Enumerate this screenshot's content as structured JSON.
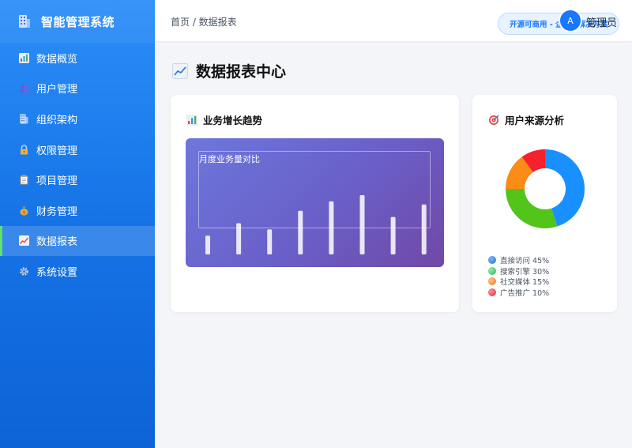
{
  "app": {
    "title": "智能管理系统"
  },
  "sidebar": {
    "items": [
      {
        "label": "数据概览",
        "icon": "bar-chart-icon",
        "active": false
      },
      {
        "label": "用户管理",
        "icon": "users-icon",
        "active": false
      },
      {
        "label": "组织架构",
        "icon": "building-icon",
        "active": false
      },
      {
        "label": "权限管理",
        "icon": "lock-icon",
        "active": false
      },
      {
        "label": "项目管理",
        "icon": "clipboard-icon",
        "active": false
      },
      {
        "label": "财务管理",
        "icon": "money-bag-icon",
        "active": false
      },
      {
        "label": "数据报表",
        "icon": "trend-chart-icon",
        "active": true
      },
      {
        "label": "系统设置",
        "icon": "gear-icon",
        "active": false
      }
    ]
  },
  "header": {
    "breadcrumb": "首页 / 数据报表",
    "promo": "开源可商用 - 企业级解决方案",
    "avatar_letter": "A",
    "username": "管理员"
  },
  "main": {
    "title": "数据报表中心",
    "growth_card": {
      "title": "业务增长趋势",
      "chart_label": "月度业务量对比"
    },
    "source_card": {
      "title": "用户来源分析"
    }
  },
  "colors": {
    "accent": "#1677ff",
    "sidebar_active_marker": "#5be36c"
  },
  "chart_data": [
    {
      "type": "bar",
      "title": "月度业务量对比",
      "categories": [
        "",
        "",
        "",
        "",
        "",
        "",
        "",
        ""
      ],
      "values": [
        30,
        50,
        40,
        70,
        85,
        95,
        60,
        80
      ],
      "ylim": [
        0,
        100
      ],
      "grid": false
    },
    {
      "type": "pie",
      "donut": true,
      "series": [
        {
          "name": "直接访问",
          "value": 45,
          "label": "直接访问 45%",
          "color": "#1890ff"
        },
        {
          "name": "搜索引擎",
          "value": 30,
          "label": "搜索引擎 30%",
          "color": "#52c41a"
        },
        {
          "name": "社交媒体",
          "value": 15,
          "label": "社交媒体 15%",
          "color": "#fa8c16"
        },
        {
          "name": "广告推广",
          "value": 10,
          "label": "广告推广 10%",
          "color": "#f5222d"
        }
      ],
      "legend": "bottom-left"
    }
  ]
}
